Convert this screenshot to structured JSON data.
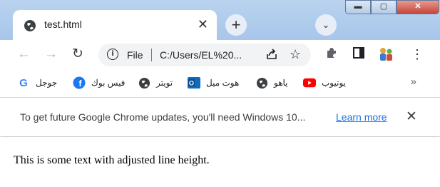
{
  "tab": {
    "title": "test.html",
    "close_label": "✕"
  },
  "newtab_label": "+",
  "tabsearch_label": "⌄",
  "window_controls": {
    "minimize": "▬",
    "maximize": "▢",
    "close": "✕"
  },
  "nav": {
    "back": "←",
    "forward": "→",
    "reload": "↻"
  },
  "omnibox": {
    "file_label": "File",
    "url": "C:/Users/EL%20..."
  },
  "bookmarks": [
    {
      "label": "جوجل",
      "icon": "google-icon"
    },
    {
      "label": "فيس بوك",
      "icon": "facebook-icon"
    },
    {
      "label": "تويتر",
      "icon": "globe-icon"
    },
    {
      "label": "هوت ميل",
      "icon": "outlook-icon"
    },
    {
      "label": "ياهو",
      "icon": "globe-icon"
    },
    {
      "label": "يوتيوب",
      "icon": "youtube-icon"
    }
  ],
  "bookmarks_overflow": "»",
  "infobar": {
    "message": "To get future Google Chrome updates, you'll need Windows 10...",
    "link": "Learn more",
    "close": "✕"
  },
  "content": {
    "text": "This is some text with adjusted line height."
  },
  "colors": {
    "titlebar": "#b9d3ef",
    "link": "#1a73e8",
    "youtube": "#ff0000",
    "facebook": "#1877f2",
    "outlook": "#0f6cbd"
  }
}
